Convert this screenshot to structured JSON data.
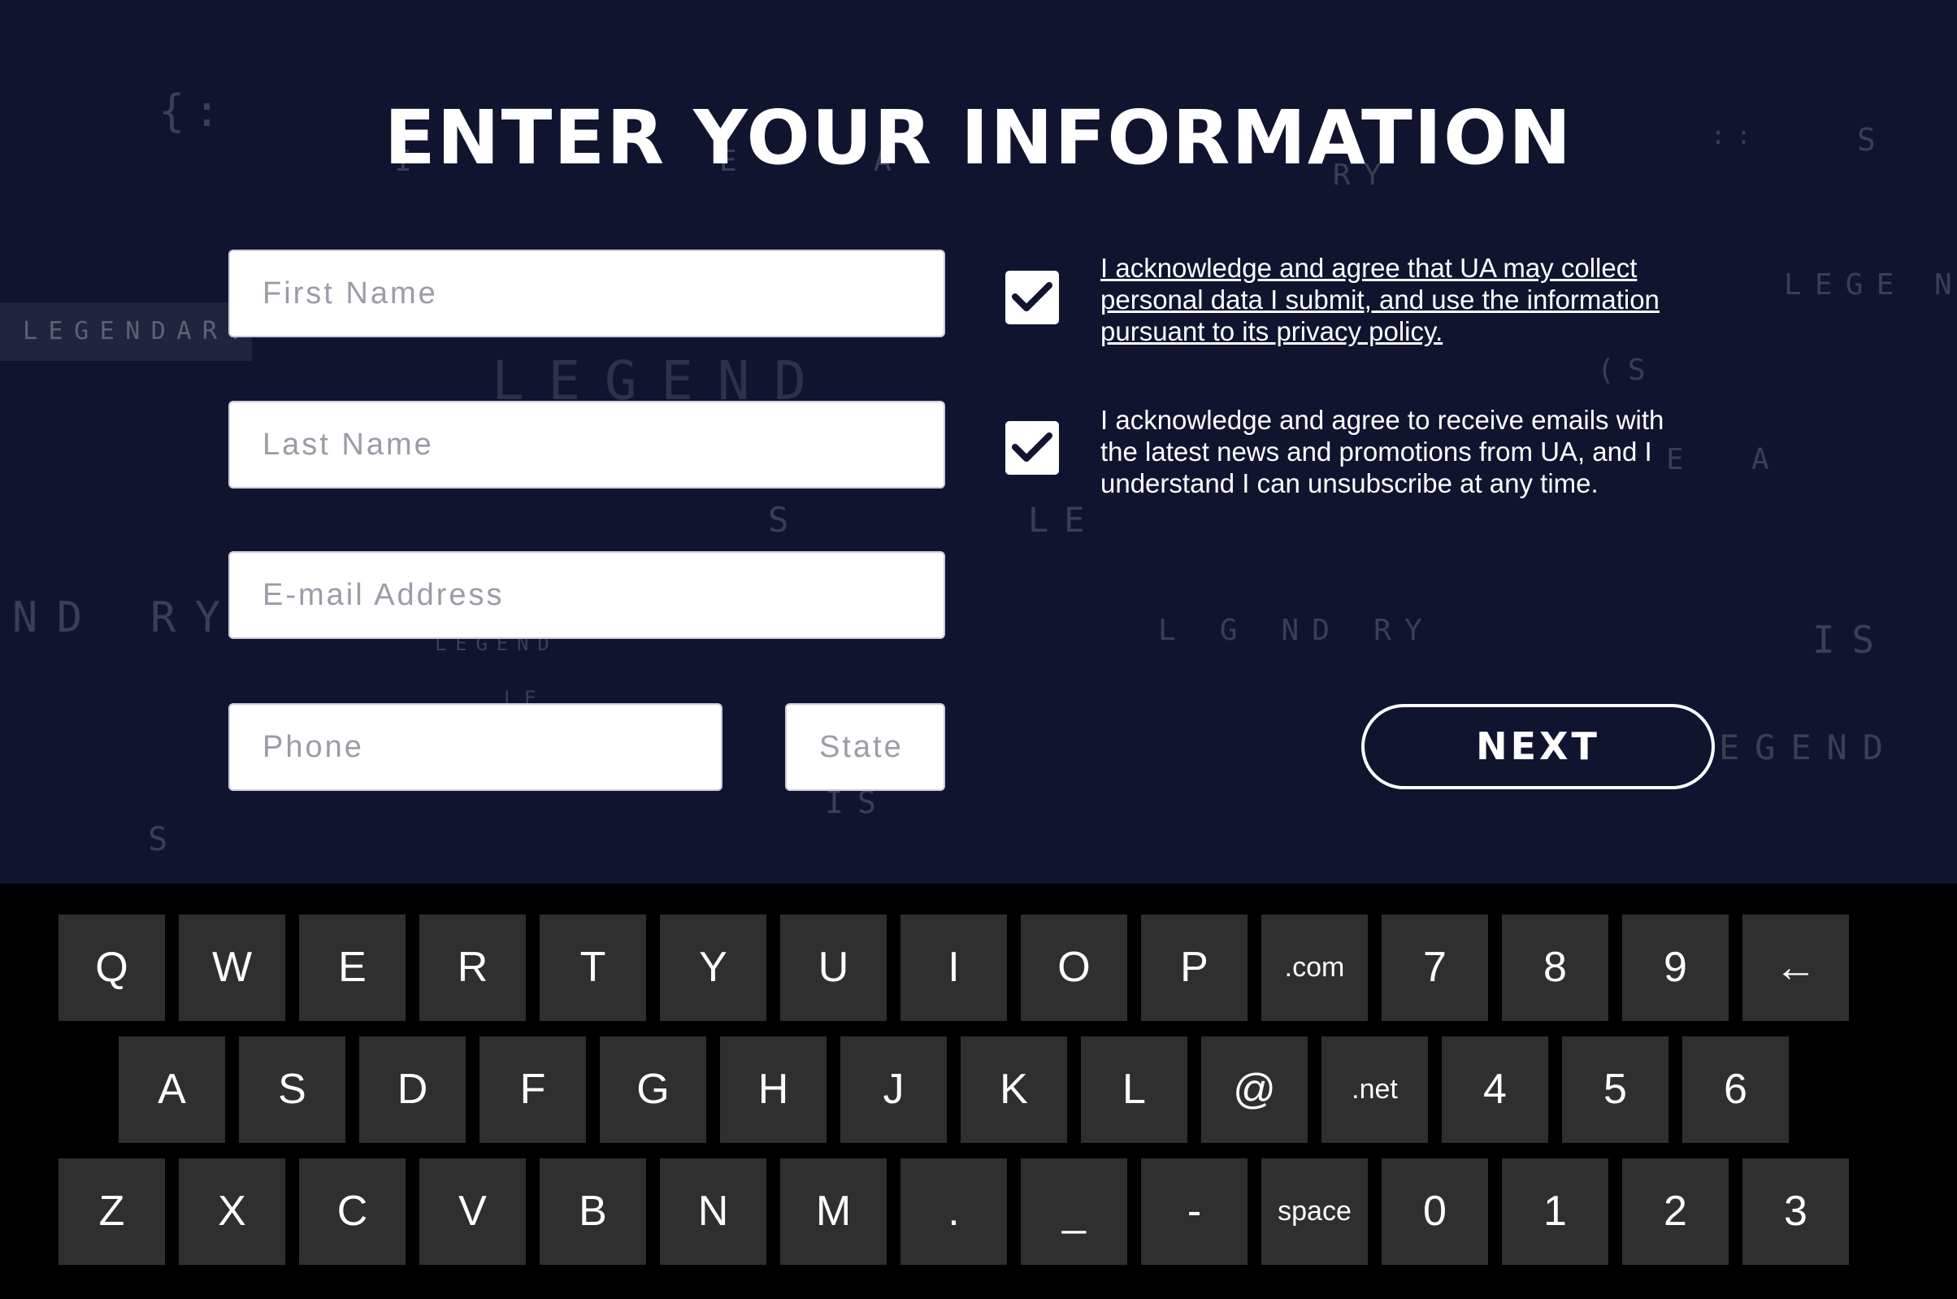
{
  "title": "ENTER YOUR INFORMATION",
  "background_words": [
    "{:",
    "I",
    "E",
    "A",
    "RY",
    "::",
    "S",
    "LEGENDARY",
    "LEGEND",
    "LEGE",
    "N",
    "(S",
    "S",
    "LE",
    "E",
    "A",
    "ND",
    "RY",
    "LEGEND",
    "LE",
    "L G ND RY",
    "IS",
    "EGEND",
    "IS",
    "S"
  ],
  "form": {
    "first_name_placeholder": "First Name",
    "last_name_placeholder": "Last Name",
    "email_placeholder": "E-mail Address",
    "phone_placeholder": "Phone",
    "state_placeholder": "State"
  },
  "consents": [
    {
      "text": "I acknowledge and agree that UA may collect personal data I submit, and use the information pursuant to its privacy policy.",
      "checked": true
    },
    {
      "text": "I acknowledge and agree to receive emails with the latest news and promotions from UA, and I understand I can unsubscribe at any time.",
      "checked": true
    }
  ],
  "next_label": "NEXT",
  "keyboard": {
    "row1": [
      "Q",
      "W",
      "E",
      "R",
      "T",
      "Y",
      "U",
      "I",
      "O",
      "P",
      ".com",
      "7",
      "8",
      "9",
      "←"
    ],
    "row2": [
      "A",
      "S",
      "D",
      "F",
      "G",
      "H",
      "J",
      "K",
      "L",
      "@",
      ".net",
      "4",
      "5",
      "6"
    ],
    "row3": [
      "Z",
      "X",
      "C",
      "V",
      "B",
      "N",
      "M",
      ".",
      "_",
      "-",
      "space",
      "0",
      "1",
      "2",
      "3"
    ]
  },
  "colors": {
    "background": "#10142f",
    "keyboard_background": "#000000",
    "key": "#2f2f2f",
    "text": "#ffffff"
  }
}
